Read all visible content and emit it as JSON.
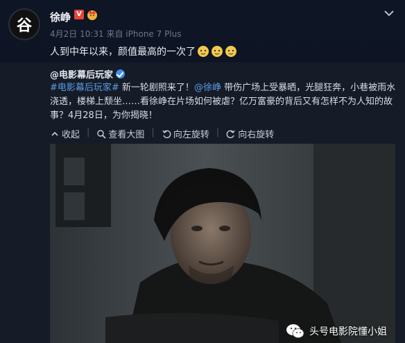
{
  "post": {
    "username": "徐峥",
    "verified_badge": "V",
    "avatar_char": "谷",
    "meta": "4月2日 10:31 来自 iPhone 7 Plus",
    "text": "人到中年以来，颜值最高的一次了",
    "emoji_name": "doge-emoji"
  },
  "repost": {
    "author": "@电影幕后玩家",
    "body_tag1": "#电影幕后玩家#",
    "body_part1": " 新一轮剧照来了！",
    "body_mention": "@徐峥",
    "body_part2": " 带伤广场上受暴晒，光腿狂奔，小巷被雨水浇透，楼梯上颓坐……看徐峥在片场如何被虐？亿万富豪的背后又有怎样不为人知的故事？4月28日，为你揭晓！",
    "actions": {
      "collapse": "收起",
      "view_large": "查看大图",
      "rotate_left": "向左旋转",
      "rotate_right": "向右旋转"
    }
  },
  "watermark": "头号电影院懂小姐",
  "colors": {
    "background": "#0d1320",
    "repost_bg": "#151b27",
    "link": "#5b9ee8",
    "verified_red": "#e8443a",
    "verified_blue": "#3f8ee6"
  }
}
